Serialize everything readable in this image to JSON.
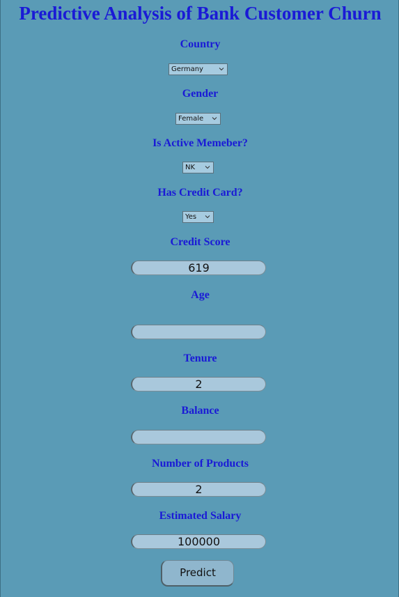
{
  "title": "Predictive Analysis of Bank Customer Churn",
  "fields": {
    "country": {
      "label": "Country",
      "value": "Germany"
    },
    "gender": {
      "label": "Gender",
      "value": "Female"
    },
    "active_member": {
      "label": "Is Active Memeber?",
      "value": "NK"
    },
    "credit_card": {
      "label": "Has Credit Card?",
      "value": "Yes"
    },
    "credit_score": {
      "label": "Credit Score",
      "value": "619"
    },
    "age": {
      "label": "Age",
      "value": ""
    },
    "tenure": {
      "label": "Tenure",
      "value": "2"
    },
    "balance": {
      "label": "Balance",
      "value": ""
    },
    "num_products": {
      "label": "Number of Products",
      "value": "2"
    },
    "estimated_salary": {
      "label": "Estimated Salary",
      "value": "100000"
    }
  },
  "predict_button": {
    "label": "Predict"
  },
  "colors": {
    "background": "#5a9bb6",
    "heading": "#1a1ad6",
    "input_fill": "#a9c8dc"
  }
}
